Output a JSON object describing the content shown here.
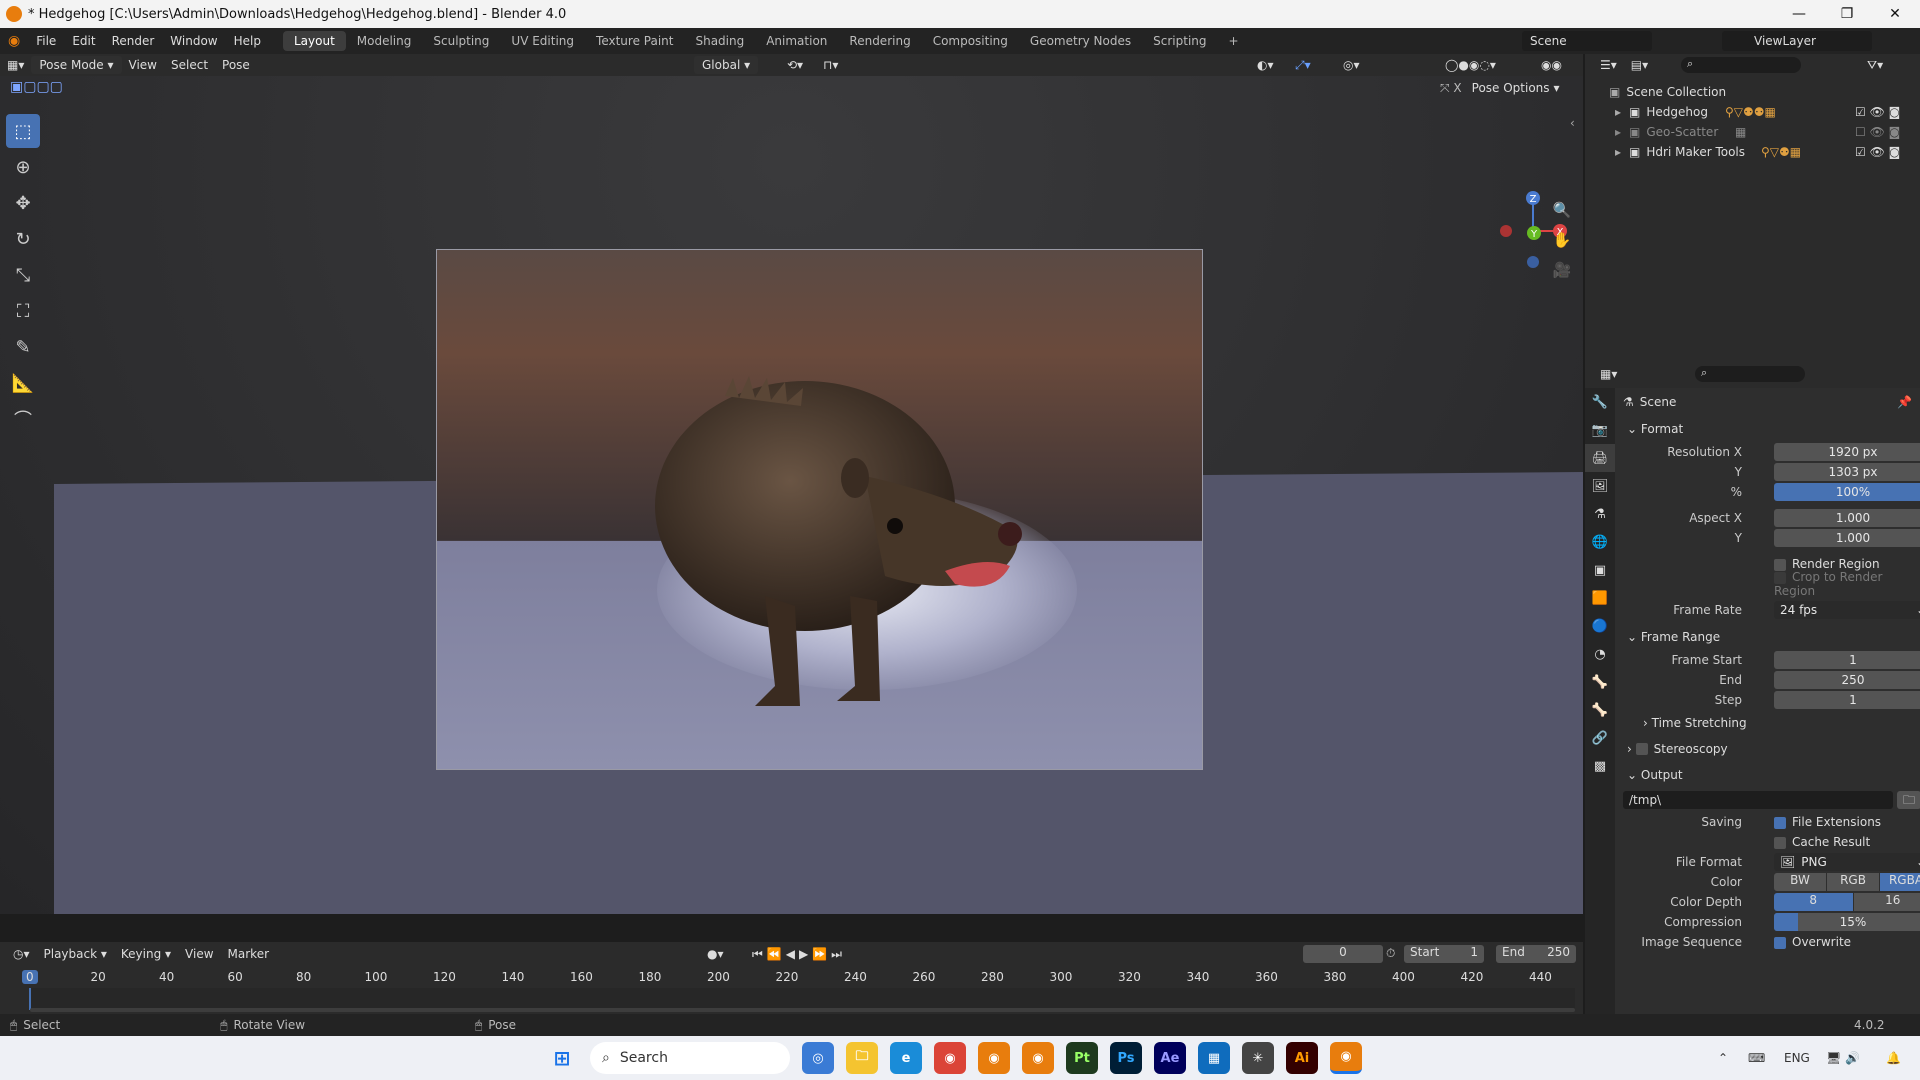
{
  "window": {
    "title": "* Hedgehog [C:\\Users\\Admin\\Downloads\\Hedgehog\\Hedgehog.blend] - Blender 4.0"
  },
  "menu": [
    "File",
    "Edit",
    "Render",
    "Window",
    "Help"
  ],
  "workspaces": [
    "Layout",
    "Modeling",
    "Sculpting",
    "UV Editing",
    "Texture Paint",
    "Shading",
    "Animation",
    "Rendering",
    "Compositing",
    "Geometry Nodes",
    "Scripting"
  ],
  "active_workspace": "Layout",
  "scene_name": "Scene",
  "view_layer": "ViewLayer",
  "viewport_header": {
    "mode": "Pose Mode",
    "view": "View",
    "select": "Select",
    "pose": "Pose",
    "orientation": "Global",
    "pose_options": "Pose Options"
  },
  "gizmo": {
    "z": "Z",
    "y": "Y",
    "x": "X"
  },
  "outliner": {
    "root": "Scene Collection",
    "items": [
      {
        "name": "Hedgehog",
        "badges": [
          "2",
          "3"
        ],
        "visible": true
      },
      {
        "name": "Geo-Scatter",
        "badges": [
          "6"
        ],
        "visible": false
      },
      {
        "name": "Hdri Maker Tools",
        "badges": [
          "2",
          "5",
          "2"
        ],
        "visible": true
      }
    ]
  },
  "properties": {
    "context": "Scene",
    "format": {
      "title": "Format",
      "resolution_x_label": "Resolution X",
      "resolution_x": "1920 px",
      "y_label": "Y",
      "resolution_y": "1303 px",
      "pct_label": "%",
      "resolution_pct": "100%",
      "aspect_x_label": "Aspect X",
      "aspect_x": "1.000",
      "aspect_y_label": "Y",
      "aspect_y": "1.000",
      "render_region": "Render Region",
      "crop_region": "Crop to Render Region",
      "frame_rate_label": "Frame Rate",
      "frame_rate": "24 fps"
    },
    "frame_range": {
      "title": "Frame Range",
      "start_label": "Frame Start",
      "start": "1",
      "end_label": "End",
      "end": "250",
      "step_label": "Step",
      "step": "1",
      "time_stretching": "Time Stretching"
    },
    "stereoscopy": "Stereoscopy",
    "output": {
      "title": "Output",
      "path": "/tmp\\",
      "saving_label": "Saving",
      "file_extensions": "File Extensions",
      "cache_result": "Cache Result",
      "file_format_label": "File Format",
      "file_format": "PNG",
      "color_label": "Color",
      "color_options": [
        "BW",
        "RGB",
        "RGBA"
      ],
      "color_selected": "RGBA",
      "color_depth_label": "Color Depth",
      "color_depth_options": [
        "8",
        "16"
      ],
      "color_depth_selected": "8",
      "compression_label": "Compression",
      "compression": "15%",
      "compression_value": 15,
      "image_sequence_label": "Image Sequence",
      "overwrite": "Overwrite"
    }
  },
  "timeline": {
    "menus": [
      "Playback",
      "Keying",
      "View",
      "Marker"
    ],
    "current_frame": "0",
    "start_label": "Start",
    "start": "1",
    "end_label": "End",
    "end": "250",
    "ticks": [
      "0",
      "20",
      "40",
      "60",
      "80",
      "100",
      "120",
      "140",
      "160",
      "180",
      "200",
      "220",
      "240",
      "260",
      "280",
      "300",
      "320",
      "340",
      "360",
      "380",
      "400",
      "420",
      "440"
    ]
  },
  "statusbar": {
    "select": "Select",
    "rotate": "Rotate View",
    "pose": "Pose",
    "version": "4.0.2"
  },
  "taskbar": {
    "search": "Search",
    "lang": "ENG"
  }
}
